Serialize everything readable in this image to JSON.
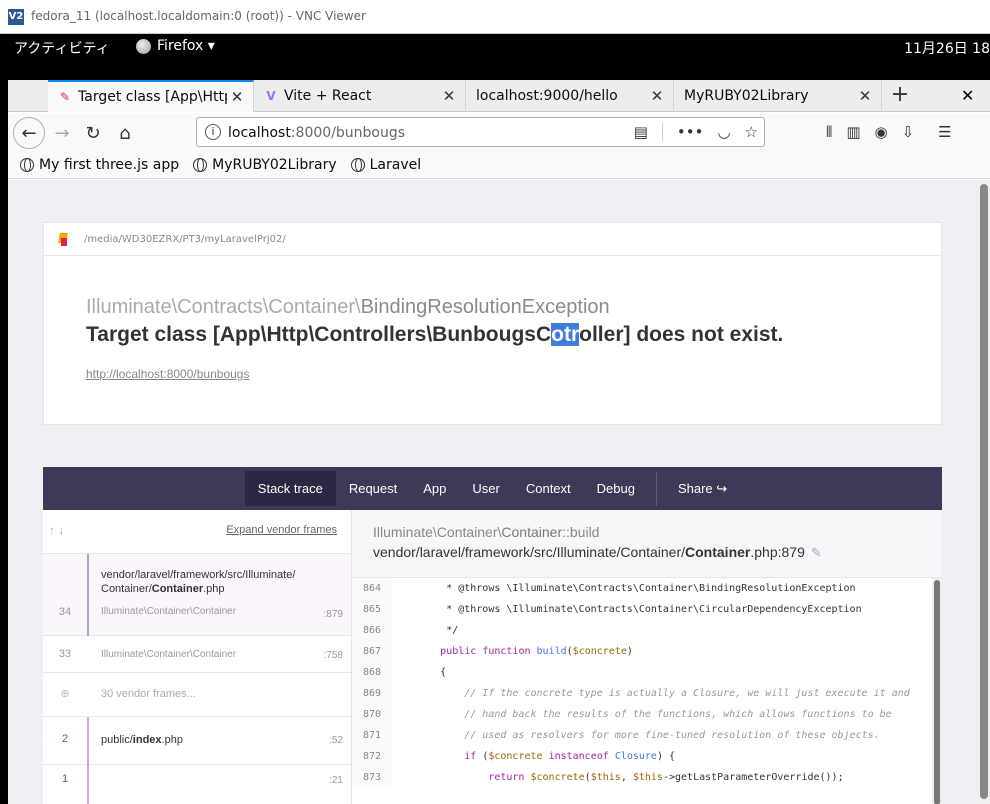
{
  "vnc": {
    "title": "fedora_11 (localhost.localdomain:0 (root)) - VNC Viewer",
    "logo": "V2"
  },
  "gnome": {
    "activities": "アクティビティ",
    "app": "Firefox ▾",
    "clock": "11月26日 18"
  },
  "tabs": [
    {
      "label": "Target class [App\\Http\\",
      "icon": "pencil-icon"
    },
    {
      "label": "Vite + React",
      "icon": "vite-icon"
    },
    {
      "label": "localhost:9000/hello",
      "icon": ""
    },
    {
      "label": "MyRUBY02Library",
      "icon": ""
    }
  ],
  "url": {
    "host": "localhost",
    "rest": ":8000/bunbougs"
  },
  "bookmarks": [
    "My first three.js app",
    "MyRUBY02Library",
    "Laravel"
  ],
  "error": {
    "path": "/media/WD30EZRX/PT3/myLaravelPrj02/",
    "namespace": "Illuminate\\Contracts\\Container\\",
    "class": "BindingResolutionException",
    "msg_before": "Target class [App\\Http\\Controllers\\BunbougsC",
    "msg_highlight": "otr",
    "msg_after": "oller] does not exist.",
    "url": "http://localhost:8000/bunbougs"
  },
  "stack_tabs": [
    "Stack trace",
    "Request",
    "App",
    "User",
    "Context",
    "Debug",
    "Share"
  ],
  "frames_head": {
    "expand": "Expand vendor frames"
  },
  "frames": {
    "f34_path_a": "vendor/laravel/framework/src/Illuminate/",
    "f34_path_b": "Container/",
    "f34_path_c": "Container",
    "f34_path_d": ".php",
    "f34_num": "34",
    "f34_cls": "Illuminate\\Container\\Container",
    "f34_ln": ":879",
    "f33_num": "33",
    "f33_cls": "Illuminate\\Container\\Container",
    "f33_ln": ":758",
    "vendor": "30 vendor frames...",
    "f2_num": "2",
    "f2_path_a": "public/",
    "f2_path_b": "index",
    "f2_path_c": ".php",
    "f2_ln": ":52",
    "f1_num": "1",
    "f1_ln": ":21"
  },
  "code": {
    "ns": "Illuminate\\Container\\",
    "cls": "Container",
    "method": "::build",
    "file_a": "vendor/laravel/framework/src/Illuminate/Container/",
    "file_b": "Container",
    "file_c": ".php:879",
    "lines": [
      {
        "n": "864",
        "t": "         * @throws \\Illuminate\\Contracts\\Container\\BindingResolutionException"
      },
      {
        "n": "865",
        "t": "         * @throws \\Illuminate\\Contracts\\Container\\CircularDependencyException"
      },
      {
        "n": "866",
        "t": "         */"
      },
      {
        "n": "867",
        "t": "        public function build($concrete)"
      },
      {
        "n": "868",
        "t": "        {"
      },
      {
        "n": "869",
        "t": "            // If the concrete type is actually a Closure, we will just execute it and"
      },
      {
        "n": "870",
        "t": "            // hand back the results of the functions, which allows functions to be"
      },
      {
        "n": "871",
        "t": "            // used as resolvers for more fine-tuned resolution of these objects."
      },
      {
        "n": "872",
        "t": "            if ($concrete instanceof Closure) {"
      },
      {
        "n": "873",
        "t": "                return $concrete($this, $this->getLastParameterOverride());"
      }
    ]
  }
}
